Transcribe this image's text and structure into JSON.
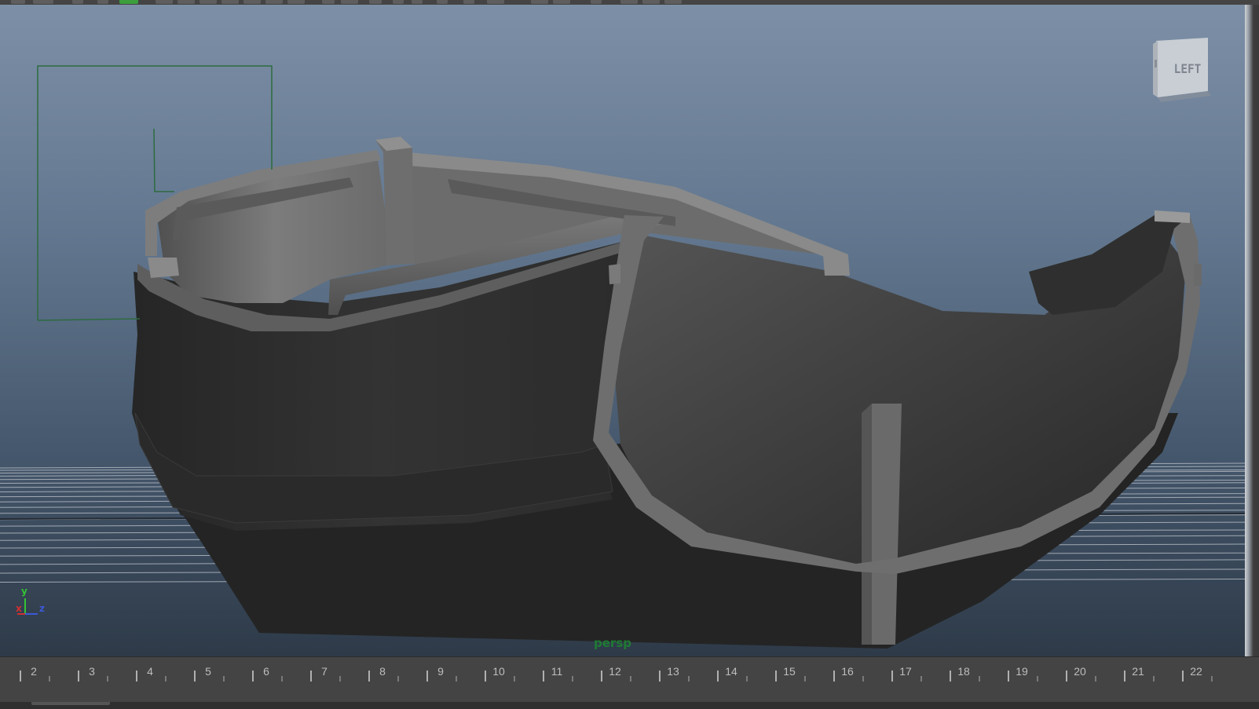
{
  "viewport": {
    "camera_name": "persp",
    "view_cube_label": "LEFT",
    "axis_labels": {
      "x": "x",
      "y": "y",
      "z": "z"
    },
    "colors": {
      "sky_top": "#7d8fa7",
      "sky_bottom": "#2e3a48",
      "grid": "#b4bac2",
      "camera_label": "#1f7a33",
      "boat_dark": "#2b2b2b",
      "boat_mid": "#4a4a4a",
      "boat_light": "#8a8a8a",
      "selection_box": "#2d6b3f"
    }
  },
  "timeline": {
    "frames": [
      "2",
      "3",
      "4",
      "5",
      "6",
      "7",
      "8",
      "9",
      "10",
      "11",
      "12",
      "13",
      "14",
      "15",
      "16",
      "17",
      "18",
      "19",
      "20",
      "21",
      "22"
    ],
    "colors": {
      "background": "#444444",
      "tick": "#b0b0b0",
      "label": "#bdbdbd"
    }
  }
}
